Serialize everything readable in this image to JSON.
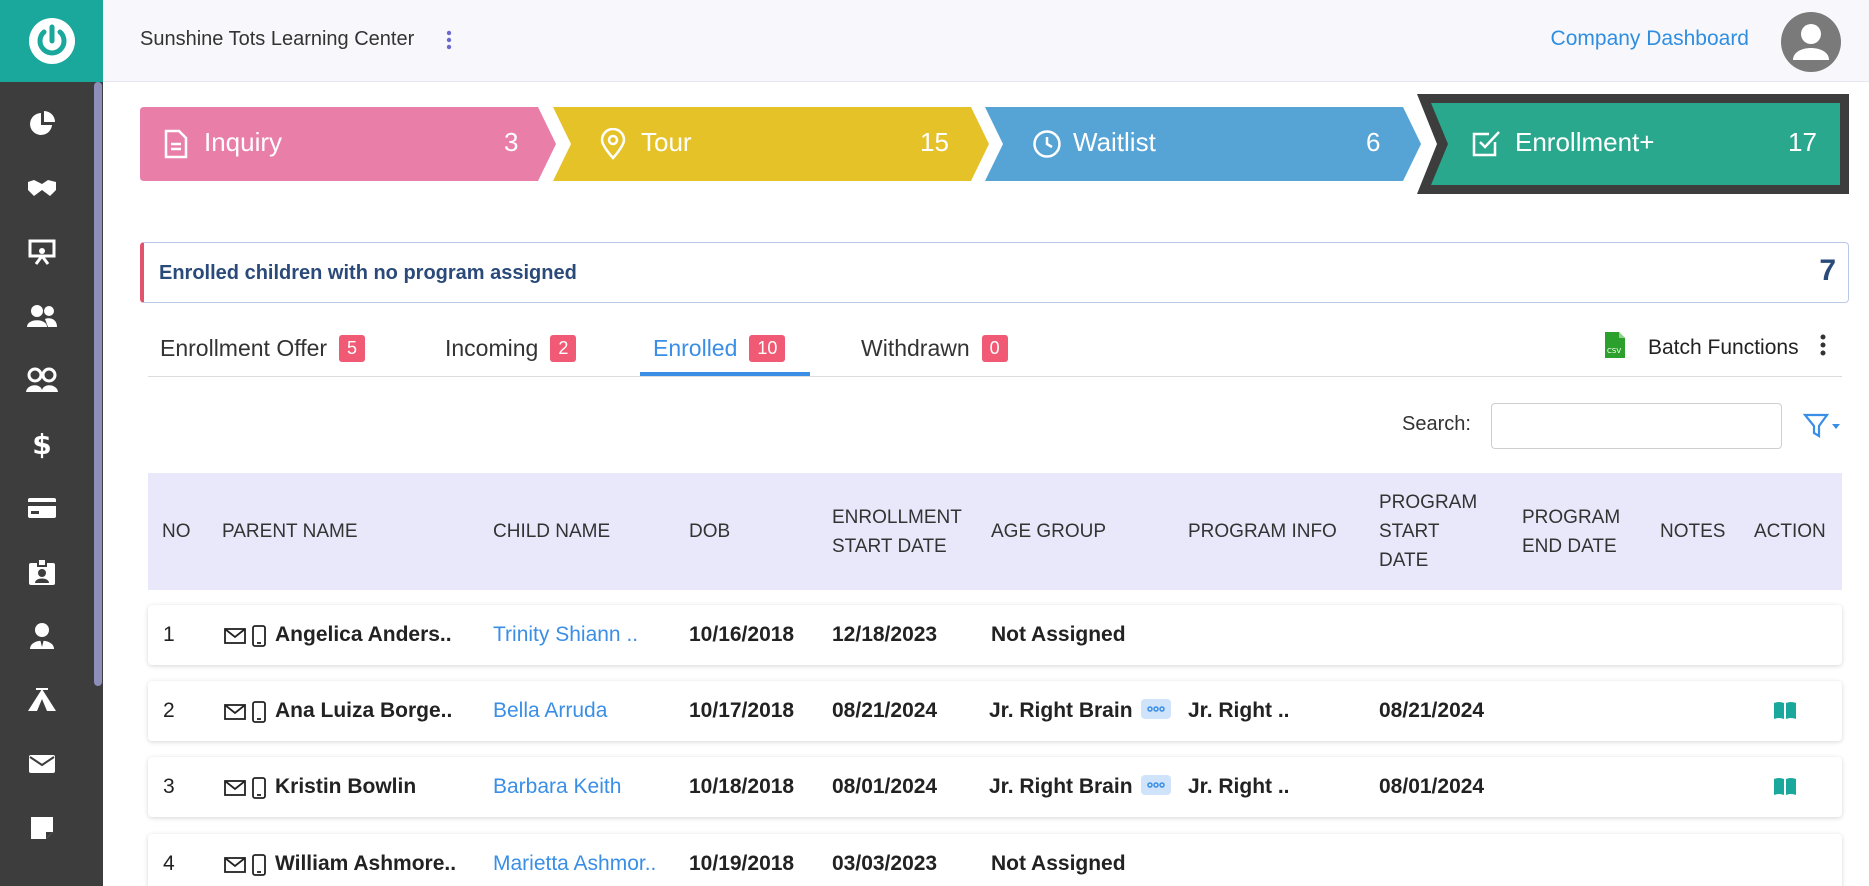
{
  "header": {
    "center_name": "Sunshine Tots Learning Center",
    "dashboard_link": "Company Dashboard"
  },
  "sidebar": {
    "items": [
      {
        "icon": "pie-chart-icon"
      },
      {
        "icon": "handshake-icon"
      },
      {
        "icon": "presentation-icon"
      },
      {
        "icon": "users-icon"
      },
      {
        "icon": "children-icon"
      },
      {
        "icon": "dollar-icon"
      },
      {
        "icon": "credit-card-icon"
      },
      {
        "icon": "id-badge-icon"
      },
      {
        "icon": "user-tie-icon"
      },
      {
        "icon": "campground-icon"
      },
      {
        "icon": "envelope-icon"
      },
      {
        "icon": "sticky-note-icon"
      }
    ]
  },
  "pipeline": [
    {
      "label": "Inquiry",
      "count": "3",
      "color": "#e97ea8",
      "icon": "document-icon"
    },
    {
      "label": "Tour",
      "count": "15",
      "color": "#e6c229",
      "icon": "map-pin-icon"
    },
    {
      "label": "Waitlist",
      "count": "6",
      "color": "#56a3d6",
      "icon": "clock-icon"
    },
    {
      "label": "Enrollment+",
      "count": "17",
      "color": "#2aa88e",
      "icon": "check-square-icon"
    }
  ],
  "alert": {
    "text": "Enrolled children with no program assigned",
    "count": "7"
  },
  "tabs": [
    {
      "label": "Enrollment Offer",
      "count": "5"
    },
    {
      "label": "Incoming",
      "count": "2"
    },
    {
      "label": "Enrolled",
      "count": "10"
    },
    {
      "label": "Withdrawn",
      "count": "0"
    }
  ],
  "batch": {
    "label": "Batch Functions",
    "csv_icon_text": "CSV"
  },
  "search": {
    "label": "Search:",
    "value": ""
  },
  "table": {
    "headers": {
      "no": "NO",
      "parent": "PARENT NAME",
      "child": "CHILD NAME",
      "dob": "DOB",
      "enroll_start_1": "ENROLLMENT",
      "enroll_start_2": "START DATE",
      "age_group": "AGE GROUP",
      "program_info": "PROGRAM INFO",
      "prog_start_1": "PROGRAM",
      "prog_start_2": "START",
      "prog_start_3": "DATE",
      "prog_end_1": "PROGRAM",
      "prog_end_2": "END DATE",
      "notes": "NOTES",
      "action": "ACTION"
    },
    "rows": [
      {
        "no": "1",
        "parent": "Angelica Anders..",
        "child": "Trinity Shiann ..",
        "dob": "10/16/2018",
        "enroll_start": "12/18/2023",
        "age_group": "Not Assigned",
        "program_info": "",
        "prog_start": "",
        "has_action": false,
        "has_more": false
      },
      {
        "no": "2",
        "parent": "Ana Luiza Borge..",
        "child": "Bella Arruda",
        "dob": "10/17/2018",
        "enroll_start": "08/21/2024",
        "age_group": "Jr. Right Brain",
        "program_info": "Jr. Right ..",
        "prog_start": "08/21/2024",
        "has_action": true,
        "has_more": true
      },
      {
        "no": "3",
        "parent": "Kristin Bowlin",
        "child": "Barbara Keith",
        "dob": "10/18/2018",
        "enroll_start": "08/01/2024",
        "age_group": "Jr. Right Brain",
        "program_info": "Jr. Right ..",
        "prog_start": "08/01/2024",
        "has_action": true,
        "has_more": true
      },
      {
        "no": "4",
        "parent": "William Ashmore..",
        "child": "Marietta Ashmor..",
        "dob": "10/19/2018",
        "enroll_start": "03/03/2023",
        "age_group": "Not Assigned",
        "program_info": "",
        "prog_start": "",
        "has_action": false,
        "has_more": false
      }
    ]
  }
}
